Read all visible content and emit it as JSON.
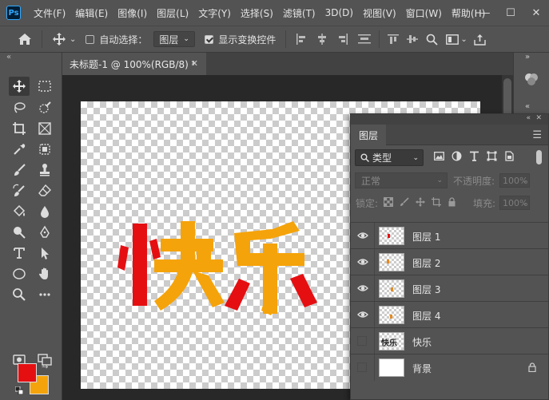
{
  "app": {
    "logo": "Ps"
  },
  "menu": [
    "文件(F)",
    "编辑(E)",
    "图像(I)",
    "图层(L)",
    "文字(Y)",
    "选择(S)",
    "滤镜(T)",
    "3D(D)",
    "视图(V)",
    "窗口(W)",
    "帮助(H)"
  ],
  "window_controls": {
    "minimize": "—",
    "maximize": "☐",
    "close": "✕"
  },
  "options": {
    "auto_select_label": "自动选择：",
    "auto_select_checked": false,
    "target_select": "图层",
    "show_transform_label": "显示变换控件",
    "show_transform_checked": true
  },
  "document": {
    "tab_title": "未标题-1 @ 100%(RGB/8) *",
    "close": "✕"
  },
  "canvas": {
    "text_chars": [
      "快",
      "乐"
    ],
    "text_colors": [
      "#e50f12",
      "#f5a30a"
    ]
  },
  "colors": {
    "foreground": "#e50f12",
    "background": "#f5a30a"
  },
  "layers_panel": {
    "title": "图层",
    "filter_kind": "类型",
    "blend_mode": "正常",
    "opacity_label": "不透明度:",
    "opacity_value": "100%",
    "lock_label": "锁定:",
    "fill_label": "填充:",
    "fill_value": "100%",
    "layers": [
      {
        "name": "图层 1",
        "visible": true,
        "thumb": "transparent"
      },
      {
        "name": "图层 2",
        "visible": true,
        "thumb": "transparent"
      },
      {
        "name": "图层 3",
        "visible": true,
        "thumb": "transparent"
      },
      {
        "name": "图层 4",
        "visible": true,
        "thumb": "transparent"
      },
      {
        "name": "快乐",
        "visible": false,
        "thumb": "text"
      },
      {
        "name": "背景",
        "visible": false,
        "thumb": "white",
        "locked": true
      }
    ]
  }
}
